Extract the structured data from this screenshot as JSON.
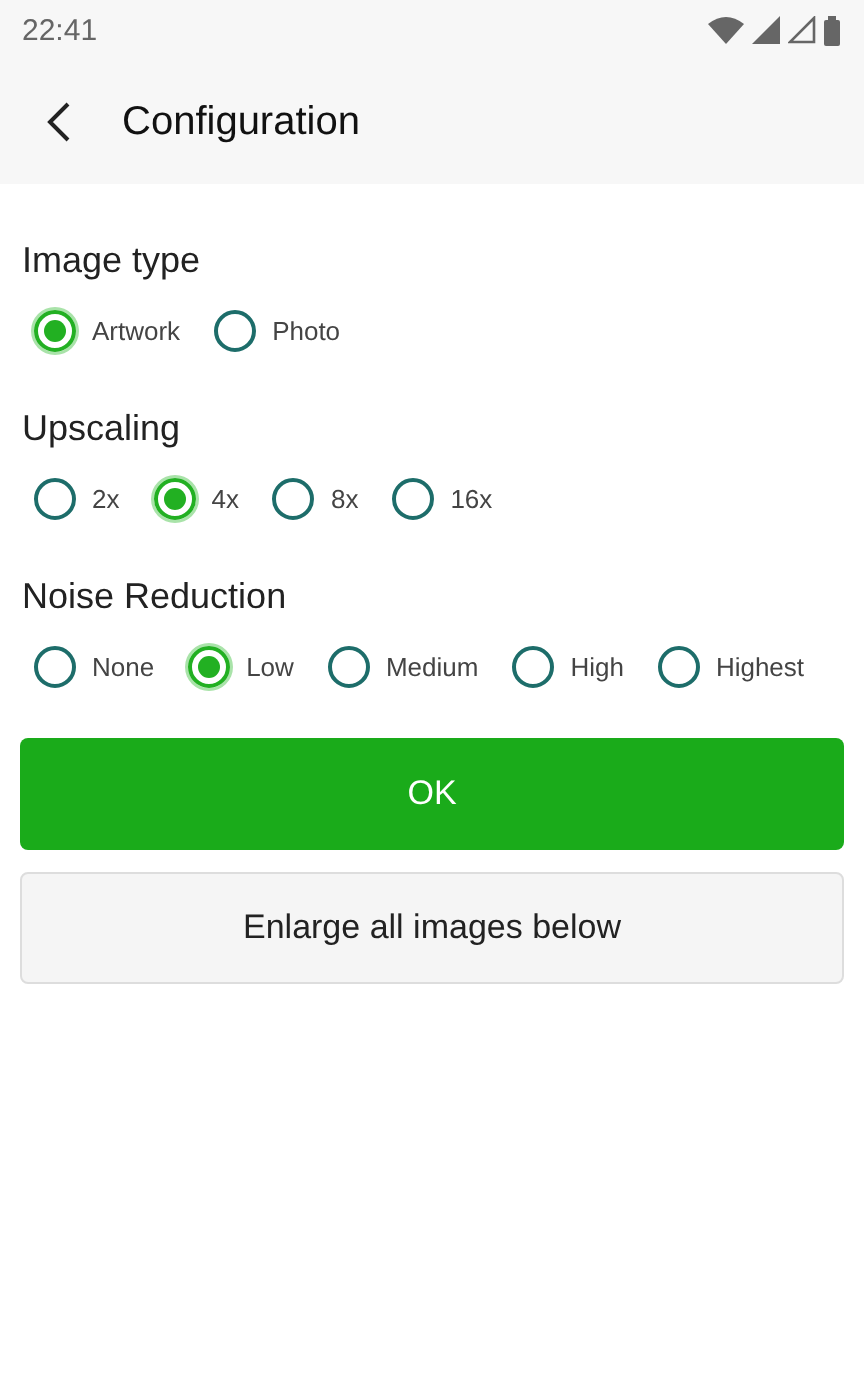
{
  "status_bar": {
    "time": "22:41"
  },
  "app_bar": {
    "title": "Configuration"
  },
  "groups": [
    {
      "title": "Image type",
      "options": [
        {
          "label": "Artwork",
          "selected": true
        },
        {
          "label": "Photo",
          "selected": false
        }
      ]
    },
    {
      "title": "Upscaling",
      "options": [
        {
          "label": "2x",
          "selected": false
        },
        {
          "label": "4x",
          "selected": true
        },
        {
          "label": "8x",
          "selected": false
        },
        {
          "label": "16x",
          "selected": false
        }
      ]
    },
    {
      "title": "Noise Reduction",
      "options": [
        {
          "label": "None",
          "selected": false
        },
        {
          "label": "Low",
          "selected": true
        },
        {
          "label": "Medium",
          "selected": false
        },
        {
          "label": "High",
          "selected": false
        },
        {
          "label": "Highest",
          "selected": false
        }
      ]
    }
  ],
  "buttons": [
    {
      "label": "OK",
      "kind": "primary"
    },
    {
      "label": "Enlarge all images below",
      "kind": "secondary"
    }
  ]
}
